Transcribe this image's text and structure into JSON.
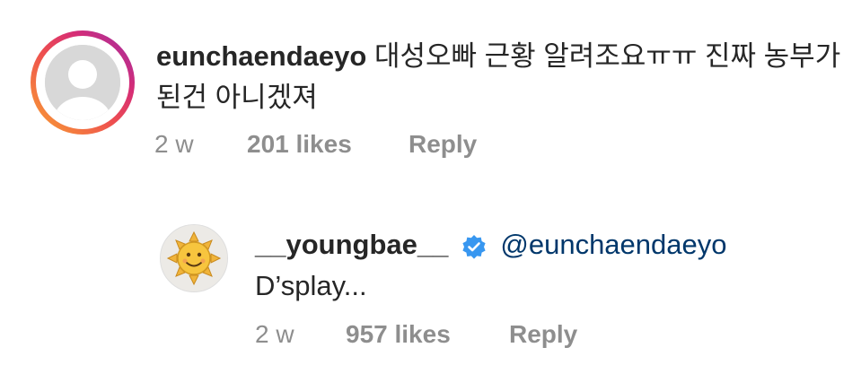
{
  "comment": {
    "username": "eunchaendaeyo",
    "text": "대성오빠 근황 알려조요ㅠㅠ 진짜 농부가 된건 아니겠져",
    "time": "2 w",
    "likes": "201 likes",
    "reply_label": "Reply",
    "avatar_icon": "default-user-avatar-icon",
    "story_ring_colors": [
      "#f9a531",
      "#ee4f4f",
      "#d62d76",
      "#9b2fa8"
    ]
  },
  "reply": {
    "username": "__youngbae__",
    "verified_icon": "verified-badge-icon",
    "verified_color": "#3897f0",
    "mention": "@eunchaendaeyo",
    "text": "D’splay...",
    "time": "2 w",
    "likes": "957 likes",
    "reply_label": "Reply",
    "avatar_icon": "sun-avatar-icon"
  }
}
